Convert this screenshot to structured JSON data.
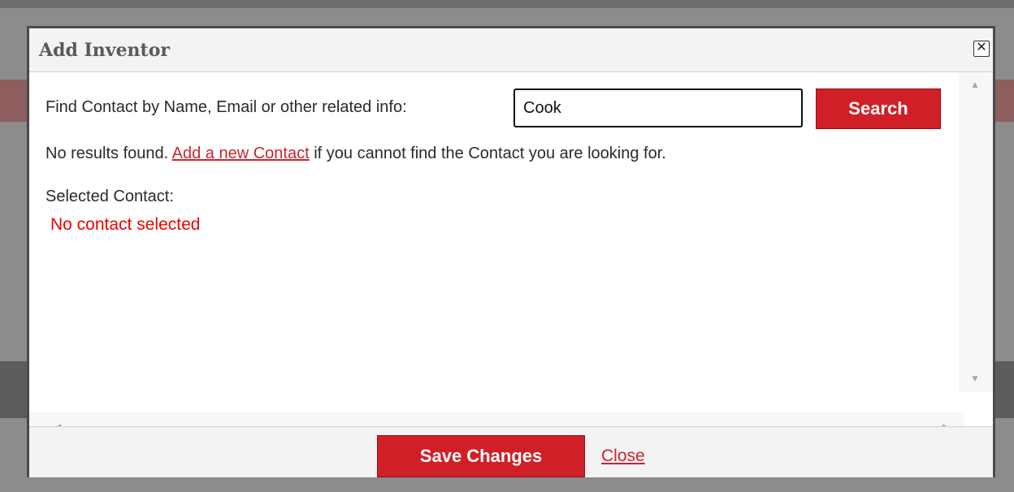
{
  "dialog": {
    "title": "Add Inventor",
    "close_icon": "close-icon",
    "find_label": "Find Contact by Name, Email or other related info:",
    "search_value": "Cook",
    "search_button": "Search",
    "no_results_prefix": "No results found.",
    "add_contact_link": "Add a new Contact",
    "no_results_suffix": "if you cannot find the Contact you are looking for.",
    "selected_label": "Selected Contact:",
    "selected_value": "No contact selected",
    "save_button": "Save Changes",
    "close_link": "Close"
  },
  "colors": {
    "accent_red": "#d11f28",
    "link_red": "#c9252c",
    "warning_red": "#f20000"
  }
}
